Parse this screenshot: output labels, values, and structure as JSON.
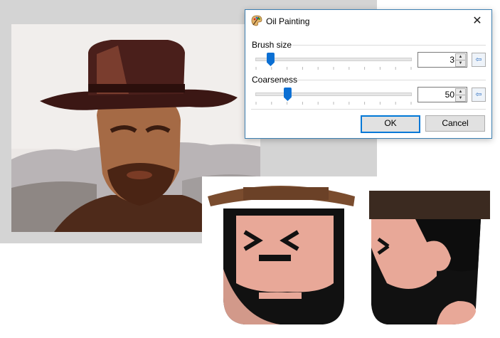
{
  "dialog": {
    "title": "Oil Painting",
    "close_glyph": "✕",
    "icon": "palette-icon",
    "accent_color": "#0078d7",
    "brush_size": {
      "label": "Brush size",
      "value": "3",
      "level": 0.08
    },
    "coarseness": {
      "label": "Coarseness",
      "value": "50",
      "level": 0.19
    },
    "reset_glyph": "⇦",
    "ok_label": "OK",
    "cancel_label": "Cancel"
  },
  "artwork": {
    "photo": "oil-painted-portrait-cowboy",
    "cartoon": "cartoon-cowboy-heads"
  }
}
